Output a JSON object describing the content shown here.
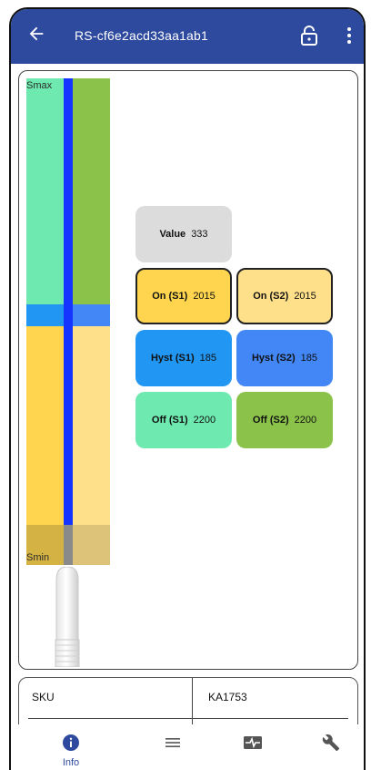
{
  "colors": {
    "appbar": "#2e4a9e",
    "needle": "#1634ff",
    "s1_upper": "#6eeab0",
    "s2_upper": "#8bc34a",
    "hyst_s1": "#2196f3",
    "hyst_s2": "#4287f5",
    "s1_lower": "#ffd54f",
    "s2_lower": "#ffe08a",
    "bottom_band_s1": "#d4b243",
    "bottom_band_s2": "#ddc27a"
  },
  "appbar": {
    "back_icon": "arrow-left-icon",
    "title": "RS-cf6e2acd33aa1ab1",
    "lock_icon": "lock-open-icon",
    "menu_icon": "more-vert-icon"
  },
  "gauge": {
    "smax_label": "Smax",
    "smin_label": "Smin"
  },
  "tiles": {
    "value": {
      "label": "Value",
      "value": "333"
    },
    "on_s1": {
      "label": "On (S1)",
      "value": "2015"
    },
    "on_s2": {
      "label": "On (S2)",
      "value": "2015"
    },
    "hyst_s1": {
      "label": "Hyst (S1)",
      "value": "185"
    },
    "hyst_s2": {
      "label": "Hyst (S2)",
      "value": "185"
    },
    "off_s1": {
      "label": "Off (S1)",
      "value": "2200"
    },
    "off_s2": {
      "label": "Off (S2)",
      "value": "2200"
    }
  },
  "info_table": {
    "key": "SKU",
    "value": "KA1753"
  },
  "bottom_nav": [
    {
      "icon": "info-icon",
      "label": "Info"
    },
    {
      "icon": "list-icon",
      "label": ""
    },
    {
      "icon": "monitor-pulse-icon",
      "label": ""
    },
    {
      "icon": "wrench-icon",
      "label": ""
    }
  ]
}
